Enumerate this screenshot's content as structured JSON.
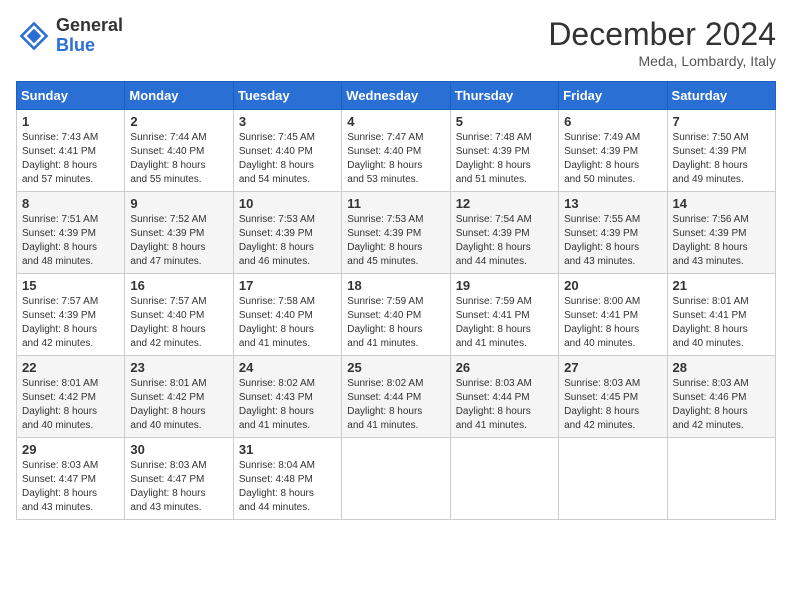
{
  "header": {
    "logo_general": "General",
    "logo_blue": "Blue",
    "month_title": "December 2024",
    "location": "Meda, Lombardy, Italy"
  },
  "days_of_week": [
    "Sunday",
    "Monday",
    "Tuesday",
    "Wednesday",
    "Thursday",
    "Friday",
    "Saturday"
  ],
  "weeks": [
    [
      {
        "day": "1",
        "lines": [
          "Sunrise: 7:43 AM",
          "Sunset: 4:41 PM",
          "Daylight: 8 hours",
          "and 57 minutes."
        ]
      },
      {
        "day": "2",
        "lines": [
          "Sunrise: 7:44 AM",
          "Sunset: 4:40 PM",
          "Daylight: 8 hours",
          "and 55 minutes."
        ]
      },
      {
        "day": "3",
        "lines": [
          "Sunrise: 7:45 AM",
          "Sunset: 4:40 PM",
          "Daylight: 8 hours",
          "and 54 minutes."
        ]
      },
      {
        "day": "4",
        "lines": [
          "Sunrise: 7:47 AM",
          "Sunset: 4:40 PM",
          "Daylight: 8 hours",
          "and 53 minutes."
        ]
      },
      {
        "day": "5",
        "lines": [
          "Sunrise: 7:48 AM",
          "Sunset: 4:39 PM",
          "Daylight: 8 hours",
          "and 51 minutes."
        ]
      },
      {
        "day": "6",
        "lines": [
          "Sunrise: 7:49 AM",
          "Sunset: 4:39 PM",
          "Daylight: 8 hours",
          "and 50 minutes."
        ]
      },
      {
        "day": "7",
        "lines": [
          "Sunrise: 7:50 AM",
          "Sunset: 4:39 PM",
          "Daylight: 8 hours",
          "and 49 minutes."
        ]
      }
    ],
    [
      {
        "day": "8",
        "lines": [
          "Sunrise: 7:51 AM",
          "Sunset: 4:39 PM",
          "Daylight: 8 hours",
          "and 48 minutes."
        ]
      },
      {
        "day": "9",
        "lines": [
          "Sunrise: 7:52 AM",
          "Sunset: 4:39 PM",
          "Daylight: 8 hours",
          "and 47 minutes."
        ]
      },
      {
        "day": "10",
        "lines": [
          "Sunrise: 7:53 AM",
          "Sunset: 4:39 PM",
          "Daylight: 8 hours",
          "and 46 minutes."
        ]
      },
      {
        "day": "11",
        "lines": [
          "Sunrise: 7:53 AM",
          "Sunset: 4:39 PM",
          "Daylight: 8 hours",
          "and 45 minutes."
        ]
      },
      {
        "day": "12",
        "lines": [
          "Sunrise: 7:54 AM",
          "Sunset: 4:39 PM",
          "Daylight: 8 hours",
          "and 44 minutes."
        ]
      },
      {
        "day": "13",
        "lines": [
          "Sunrise: 7:55 AM",
          "Sunset: 4:39 PM",
          "Daylight: 8 hours",
          "and 43 minutes."
        ]
      },
      {
        "day": "14",
        "lines": [
          "Sunrise: 7:56 AM",
          "Sunset: 4:39 PM",
          "Daylight: 8 hours",
          "and 43 minutes."
        ]
      }
    ],
    [
      {
        "day": "15",
        "lines": [
          "Sunrise: 7:57 AM",
          "Sunset: 4:39 PM",
          "Daylight: 8 hours",
          "and 42 minutes."
        ]
      },
      {
        "day": "16",
        "lines": [
          "Sunrise: 7:57 AM",
          "Sunset: 4:40 PM",
          "Daylight: 8 hours",
          "and 42 minutes."
        ]
      },
      {
        "day": "17",
        "lines": [
          "Sunrise: 7:58 AM",
          "Sunset: 4:40 PM",
          "Daylight: 8 hours",
          "and 41 minutes."
        ]
      },
      {
        "day": "18",
        "lines": [
          "Sunrise: 7:59 AM",
          "Sunset: 4:40 PM",
          "Daylight: 8 hours",
          "and 41 minutes."
        ]
      },
      {
        "day": "19",
        "lines": [
          "Sunrise: 7:59 AM",
          "Sunset: 4:41 PM",
          "Daylight: 8 hours",
          "and 41 minutes."
        ]
      },
      {
        "day": "20",
        "lines": [
          "Sunrise: 8:00 AM",
          "Sunset: 4:41 PM",
          "Daylight: 8 hours",
          "and 40 minutes."
        ]
      },
      {
        "day": "21",
        "lines": [
          "Sunrise: 8:01 AM",
          "Sunset: 4:41 PM",
          "Daylight: 8 hours",
          "and 40 minutes."
        ]
      }
    ],
    [
      {
        "day": "22",
        "lines": [
          "Sunrise: 8:01 AM",
          "Sunset: 4:42 PM",
          "Daylight: 8 hours",
          "and 40 minutes."
        ]
      },
      {
        "day": "23",
        "lines": [
          "Sunrise: 8:01 AM",
          "Sunset: 4:42 PM",
          "Daylight: 8 hours",
          "and 40 minutes."
        ]
      },
      {
        "day": "24",
        "lines": [
          "Sunrise: 8:02 AM",
          "Sunset: 4:43 PM",
          "Daylight: 8 hours",
          "and 41 minutes."
        ]
      },
      {
        "day": "25",
        "lines": [
          "Sunrise: 8:02 AM",
          "Sunset: 4:44 PM",
          "Daylight: 8 hours",
          "and 41 minutes."
        ]
      },
      {
        "day": "26",
        "lines": [
          "Sunrise: 8:03 AM",
          "Sunset: 4:44 PM",
          "Daylight: 8 hours",
          "and 41 minutes."
        ]
      },
      {
        "day": "27",
        "lines": [
          "Sunrise: 8:03 AM",
          "Sunset: 4:45 PM",
          "Daylight: 8 hours",
          "and 42 minutes."
        ]
      },
      {
        "day": "28",
        "lines": [
          "Sunrise: 8:03 AM",
          "Sunset: 4:46 PM",
          "Daylight: 8 hours",
          "and 42 minutes."
        ]
      }
    ],
    [
      {
        "day": "29",
        "lines": [
          "Sunrise: 8:03 AM",
          "Sunset: 4:47 PM",
          "Daylight: 8 hours",
          "and 43 minutes."
        ]
      },
      {
        "day": "30",
        "lines": [
          "Sunrise: 8:03 AM",
          "Sunset: 4:47 PM",
          "Daylight: 8 hours",
          "and 43 minutes."
        ]
      },
      {
        "day": "31",
        "lines": [
          "Sunrise: 8:04 AM",
          "Sunset: 4:48 PM",
          "Daylight: 8 hours",
          "and 44 minutes."
        ]
      },
      null,
      null,
      null,
      null
    ]
  ]
}
